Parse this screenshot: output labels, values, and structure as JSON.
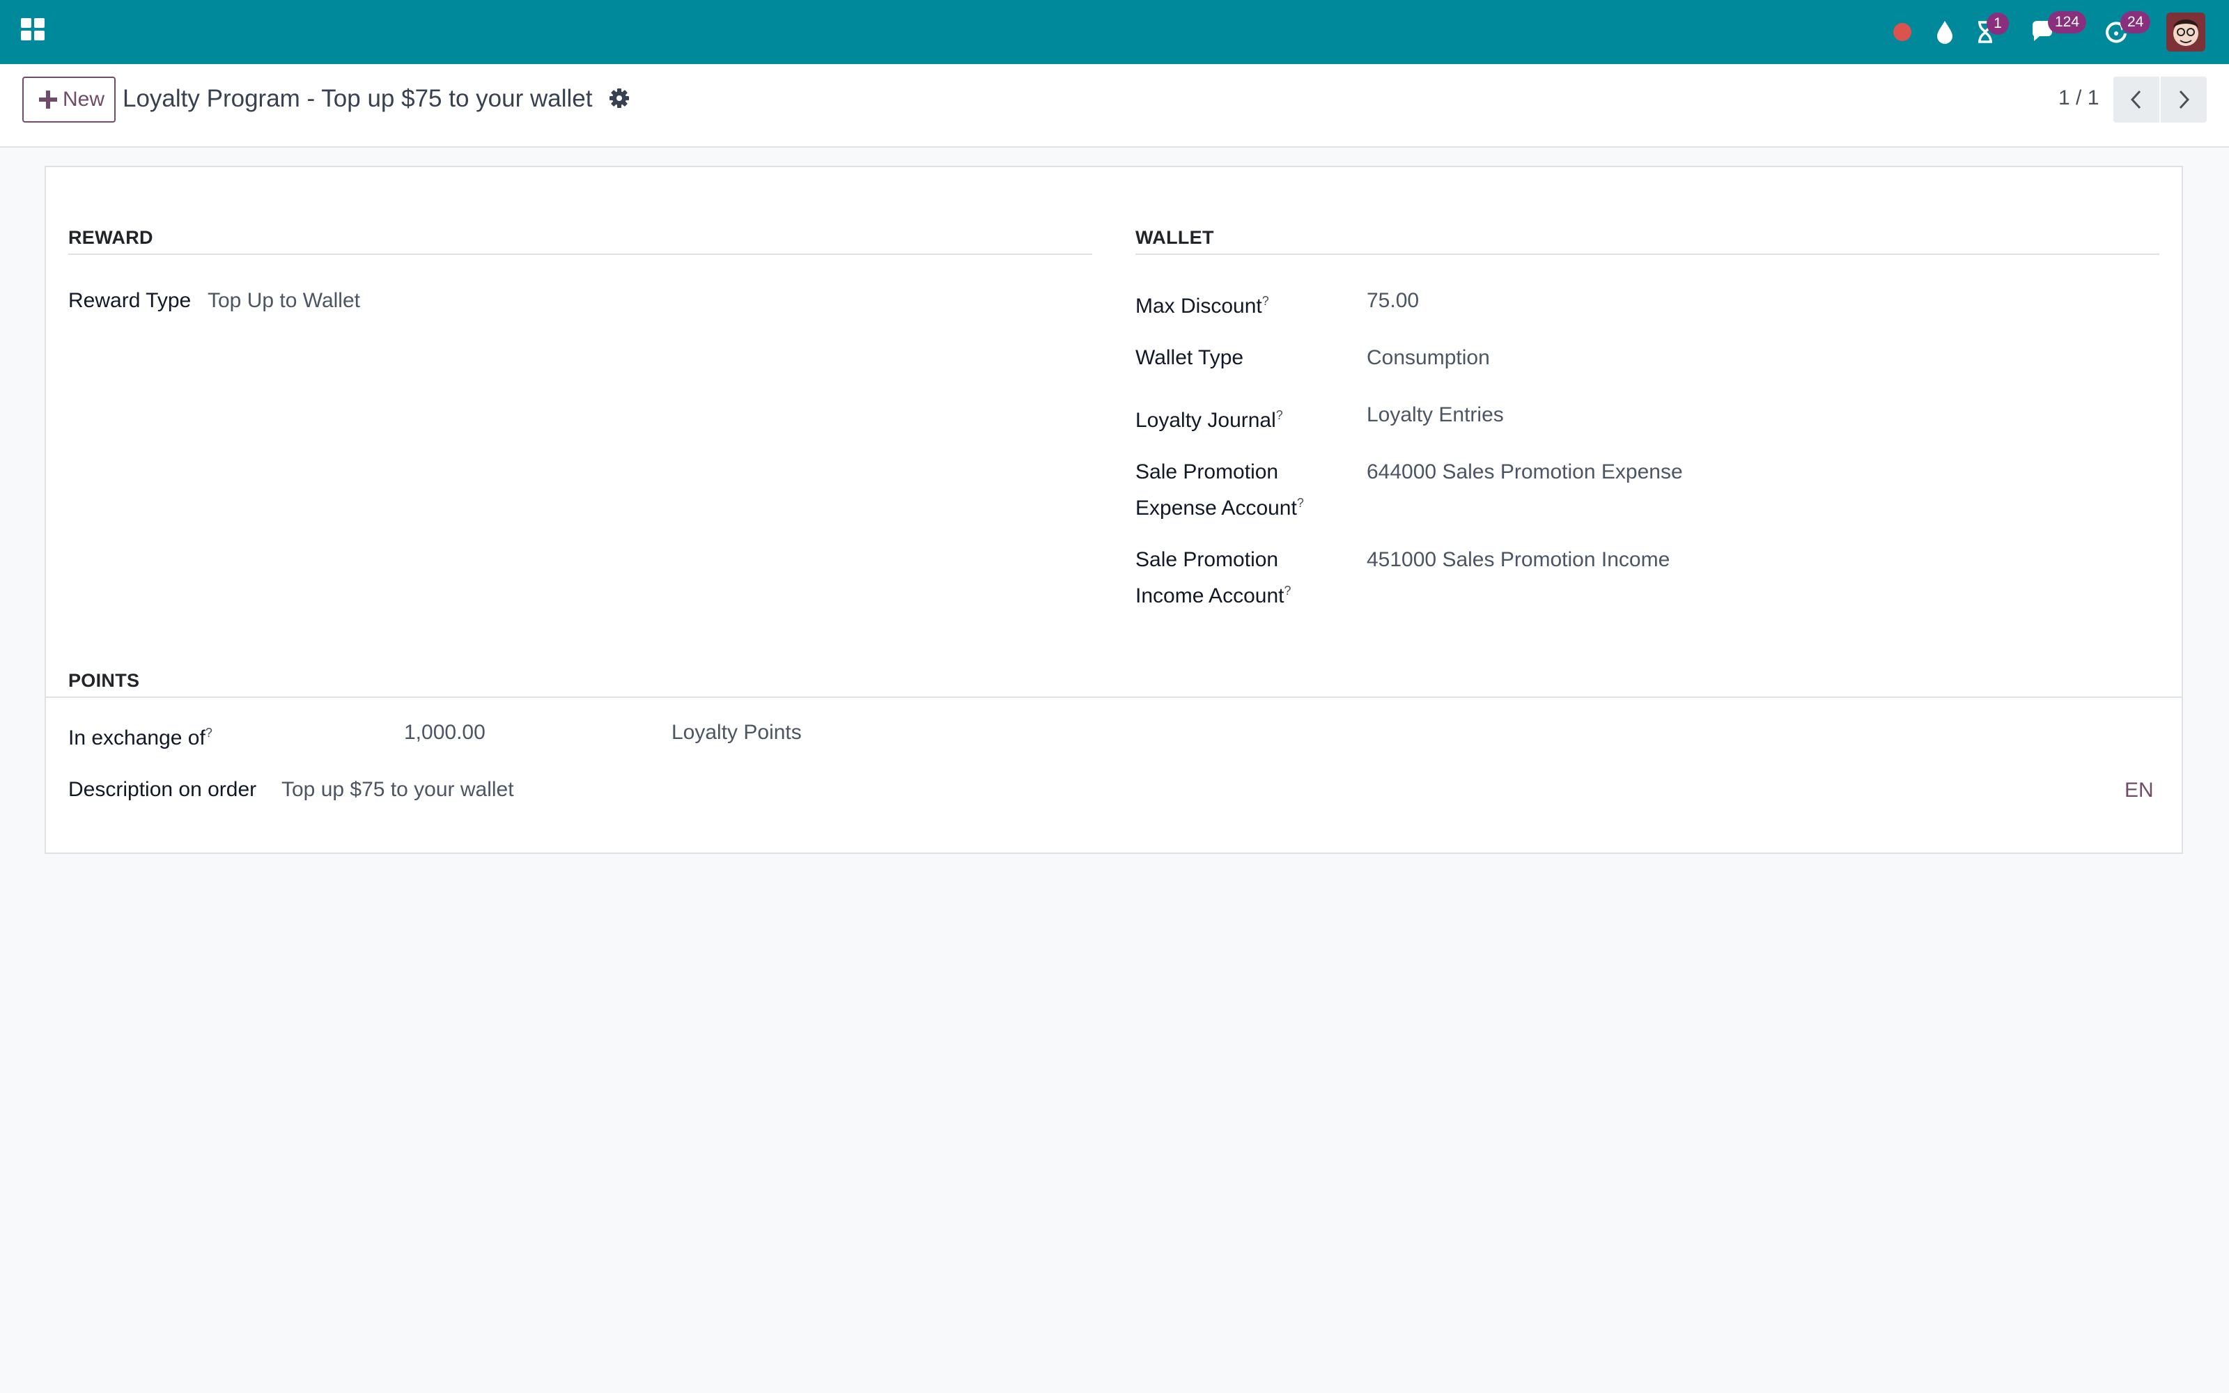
{
  "navbar": {
    "badges": {
      "activities": "1",
      "messages": "124",
      "updates": "24"
    }
  },
  "control_panel": {
    "new_label": "New",
    "title": "Loyalty Program - Top up $75 to your wallet",
    "pager": "1 / 1"
  },
  "reward": {
    "section_title": "REWARD",
    "reward_type_label": "Reward Type",
    "reward_type_value": "Top Up to Wallet"
  },
  "wallet": {
    "section_title": "WALLET",
    "max_discount_label": "Max Discount",
    "max_discount_value": "75.00",
    "wallet_type_label": "Wallet Type",
    "wallet_type_value": "Consumption",
    "loyalty_journal_label": "Loyalty Journal",
    "loyalty_journal_value": "Loyalty Entries",
    "expense_account_label_1": "Sale Promotion",
    "expense_account_label_2": "Expense Account",
    "expense_account_value": "644000 Sales Promotion Expense",
    "income_account_label_1": "Sale Promotion",
    "income_account_label_2": "Income Account",
    "income_account_value": "451000 Sales Promotion Income"
  },
  "points": {
    "section_title": "POINTS",
    "exchange_label": "In exchange of",
    "exchange_value": "1,000.00",
    "exchange_unit": "Loyalty Points",
    "description_label": "Description on order",
    "description_value": "Top up $75 to your wallet",
    "lang": "EN"
  },
  "help_marker": "?",
  "colors": {
    "navbar": "#00899a",
    "accent": "#714b67",
    "badge": "#8a2f7e",
    "record_dot": "#d9534f"
  }
}
